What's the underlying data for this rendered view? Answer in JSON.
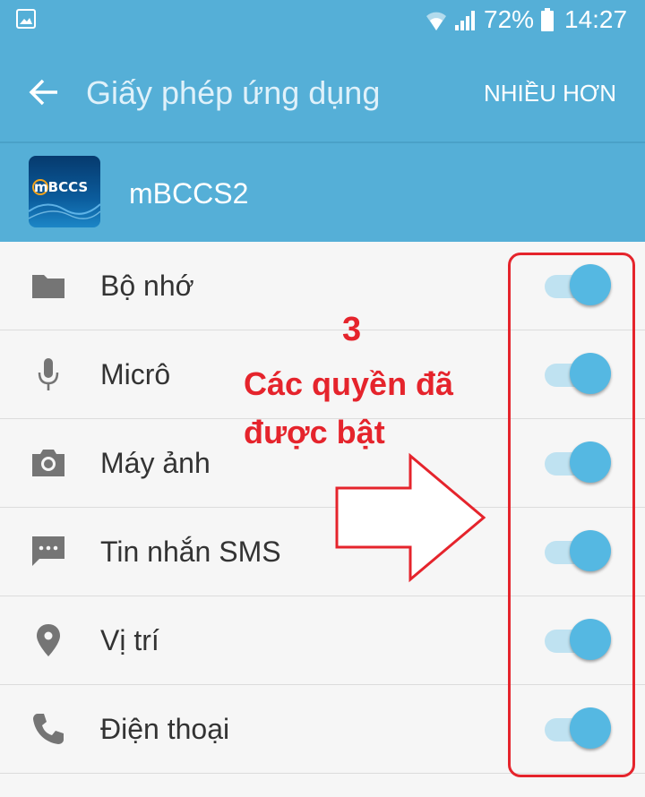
{
  "status_bar": {
    "icons": [
      "gallery-icon",
      "wifi-icon",
      "signal-icon",
      "battery-icon"
    ],
    "battery_percent": "72%",
    "time": "14:27"
  },
  "app_bar": {
    "back_icon": "arrow-left-icon",
    "title": "Giấy phép ứng dụng",
    "more_label": "NHIỀU HƠN"
  },
  "app": {
    "name": "mBCCS2",
    "icon_text": "mBCCS"
  },
  "permissions": [
    {
      "label": "Bộ nhớ",
      "icon": "folder-icon",
      "enabled": true
    },
    {
      "label": "Micrô",
      "icon": "microphone-icon",
      "enabled": true
    },
    {
      "label": "Máy ảnh",
      "icon": "camera-icon",
      "enabled": true
    },
    {
      "label": "Tin nhắn SMS",
      "icon": "sms-icon",
      "enabled": true
    },
    {
      "label": "Vị trí",
      "icon": "location-icon",
      "enabled": true
    },
    {
      "label": "Điện thoại",
      "icon": "phone-icon",
      "enabled": true
    }
  ],
  "annotation": {
    "number": "3",
    "text": "Các quyền đã được bật",
    "color": "#e5242c"
  },
  "colors": {
    "primary": "#55afd7",
    "toggle_on": "#55b8e2",
    "toggle_track": "#bfe2f1",
    "background": "#f6f6f6"
  }
}
